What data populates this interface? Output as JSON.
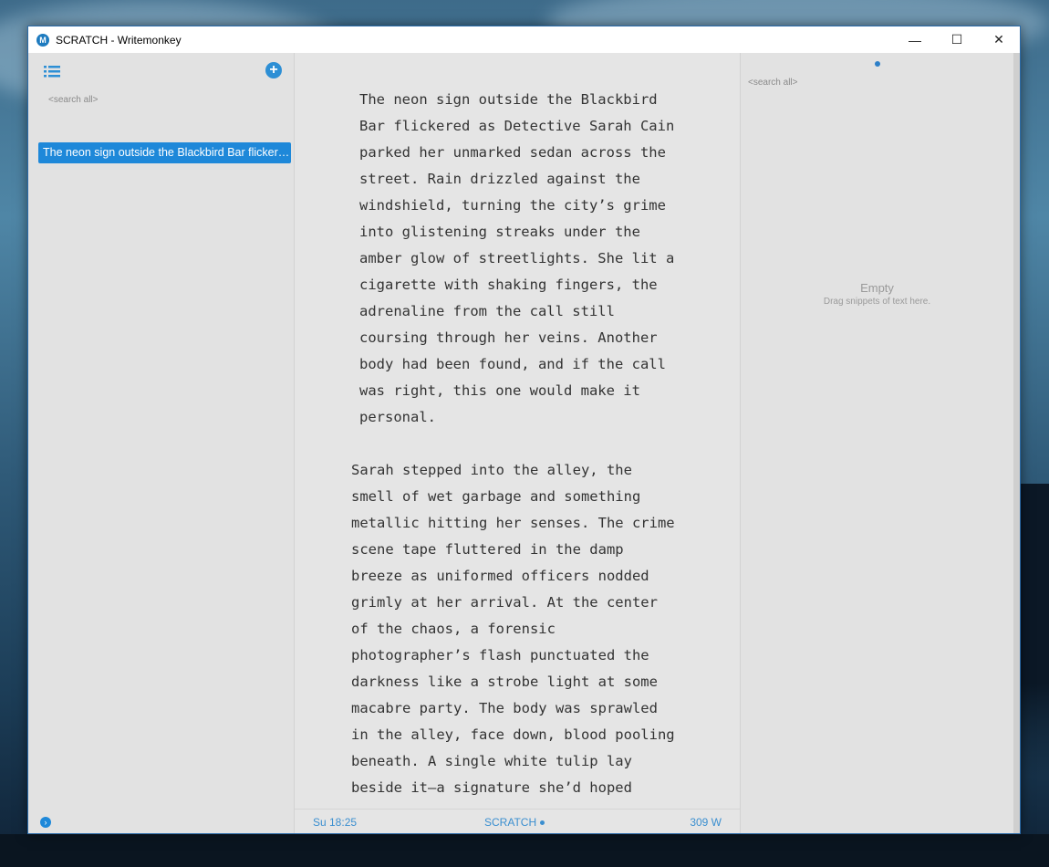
{
  "window": {
    "title": "SCRATCH - Writemonkey",
    "logo_letter": "M",
    "controls": {
      "minimize": "—",
      "maximize": "☐",
      "close": "✕"
    }
  },
  "left_pane": {
    "search_placeholder": "<search all>",
    "documents": [
      {
        "label": "The neon sign outside the Blackbird Bar flickered as Detective Sarah Cain parked her unmarked sedan across the street.",
        "selected": true
      }
    ],
    "icons": {
      "list": "list-icon",
      "add": "add-circle-icon",
      "expand": "chevron-right-circle-icon"
    }
  },
  "editor": {
    "paragraphs": [
      "The neon sign outside the Blackbird\nBar flickered as Detective Sarah Cain\nparked her unmarked sedan across the\nstreet. Rain drizzled against the\nwindshield, turning the city’s grime\ninto glistening streaks under the\namber glow of streetlights. She lit a\ncigarette with shaking fingers, the\nadrenaline from the call still\ncoursing through her veins. Another\nbody had been found, and if the call\nwas right, this one would make it\npersonal.",
      "Sarah stepped into the alley, the\nsmell of wet garbage and something\nmetallic hitting her senses. The crime\nscene tape fluttered in the damp\nbreeze as uniformed officers nodded\ngrimly at her arrival. At the center\nof the chaos, a forensic\nphotographer’s flash punctuated the\ndarkness like a strobe light at some\nmacabre party. The body was sprawled\nin the alley, face down, blood pooling\nbeneath. A single white tulip lay\nbeside it—a signature she’d hoped"
    ]
  },
  "status_bar": {
    "time": "Su 18:25",
    "document": "SCRATCH",
    "word_count": "309 W"
  },
  "right_pane": {
    "search_placeholder": "<search all>",
    "empty_title": "Empty",
    "empty_subtitle": "Drag snippets of text here."
  },
  "colors": {
    "accent": "#1e88d9",
    "status_text": "#3b8fd0"
  }
}
